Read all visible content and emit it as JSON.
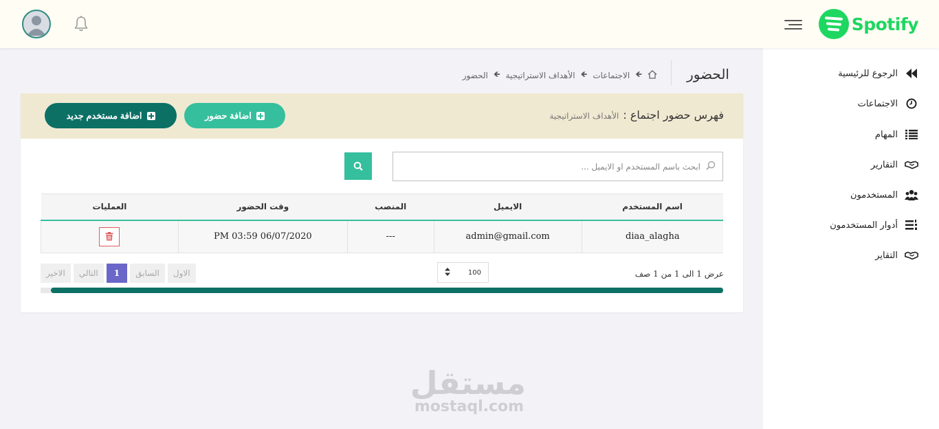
{
  "brand": {
    "name": "Spotify",
    "color": "#1ed760"
  },
  "colors": {
    "primary": "#35bf9d",
    "dark": "#0c7065",
    "header_band": "#f0e9d2",
    "pager_active": "#6a67c9",
    "danger": "#e05a5a"
  },
  "header": {
    "menu_icon": "hamburger-icon",
    "notification_icon": "bell-icon",
    "avatar_icon": "user-avatar-icon"
  },
  "sidebar": {
    "items": [
      {
        "label": "الرجوع للرئيسية",
        "icon": "fast-backward-icon"
      },
      {
        "label": "الاجتماعات",
        "icon": "clock-icon"
      },
      {
        "label": "المهام",
        "icon": "list-icon"
      },
      {
        "label": "التقارير",
        "icon": "handshake-icon"
      },
      {
        "label": "المستخدمون",
        "icon": "users-icon"
      },
      {
        "label": "أدوار المستخدمون",
        "icon": "list-ol-icon"
      },
      {
        "label": "التقاير",
        "icon": "handshake-icon"
      }
    ]
  },
  "page": {
    "title": "الحضور",
    "breadcrumb": [
      "الاجتماعات",
      "الأهداف الاستراتيجية",
      "الحضور"
    ]
  },
  "card": {
    "title": "فهرس حضور اجتماع :",
    "subtitle": "الأهداف الاستراتيجية",
    "add_attendance": "اضافة حضور",
    "add_user": "اضافة مستخدم جديد"
  },
  "search": {
    "placeholder": "ابحث باسم المستخدم او الايميل ..."
  },
  "table": {
    "headers": [
      "اسم المستخدم",
      "الايميل",
      "المنصب",
      "وقت الحضور",
      "العمليات"
    ],
    "rows": [
      {
        "username": "diaa_alagha",
        "email": "admin@gmail.com",
        "position": "---",
        "time": "PM 03:59 06/07/2020"
      }
    ]
  },
  "pagination": {
    "info": "عرض 1 الى 1 من 1 صف",
    "per_page": "100",
    "first": "الاول",
    "prev": "السابق",
    "current": "1",
    "next": "التالي",
    "last": "الاخير"
  },
  "watermark": {
    "ar": "مستقل",
    "en": "mostaql.com"
  }
}
